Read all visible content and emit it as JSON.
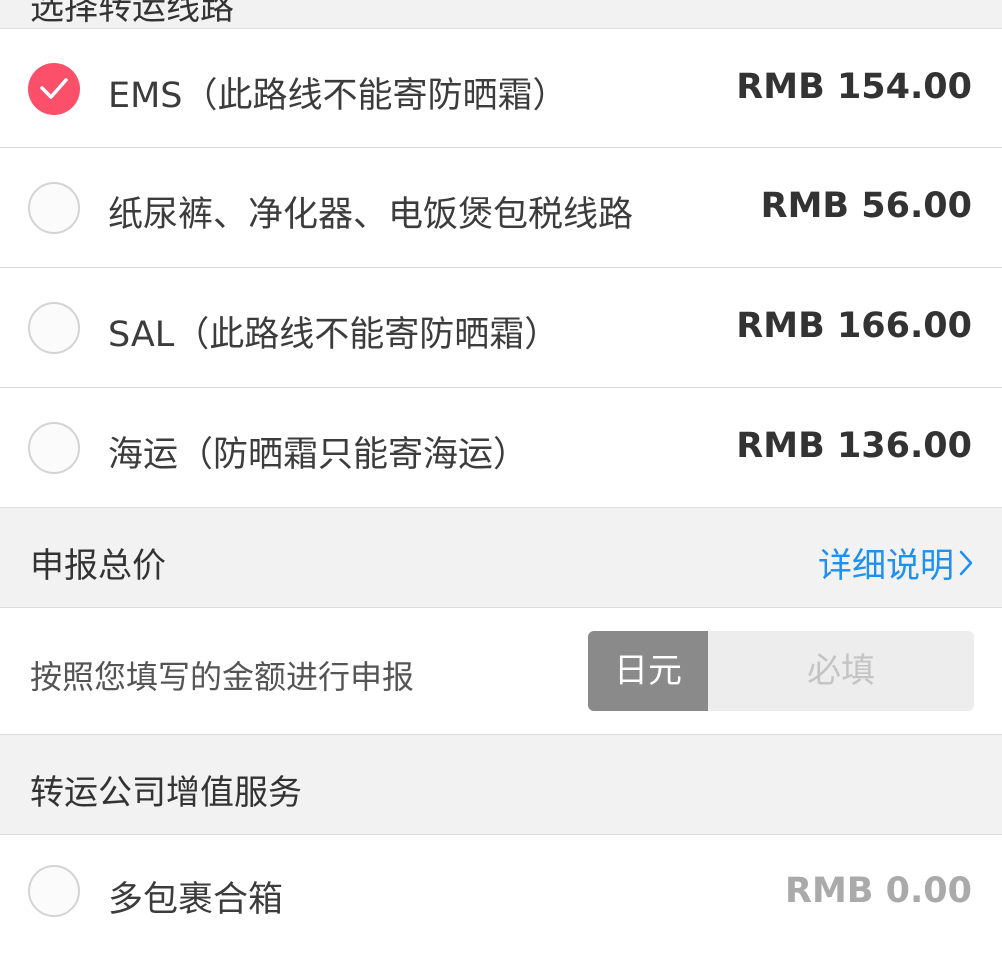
{
  "route_section": {
    "title": "选择转运线路",
    "options": [
      {
        "label": "EMS（此路线不能寄防晒霜）",
        "price": "RMB 154.00",
        "selected": true
      },
      {
        "label": "纸尿裤、净化器、电饭煲包税线路",
        "price": "RMB 56.00",
        "selected": false
      },
      {
        "label": "SAL（此路线不能寄防晒霜）",
        "price": "RMB 166.00",
        "selected": false
      },
      {
        "label": "海运（防晒霜只能寄海运）",
        "price": "RMB 136.00",
        "selected": false
      }
    ]
  },
  "declare_section": {
    "title": "申报总价",
    "detail_link": "详细说明",
    "description": "按照您填写的金额进行申报",
    "currency_unit": "日元",
    "amount_placeholder": "必填"
  },
  "service_section": {
    "title": "转运公司增值服务",
    "options": [
      {
        "label": "多包裹合箱",
        "price": "RMB 0.00",
        "selected": false
      }
    ]
  },
  "colors": {
    "accent_selected": "#fb4f6a",
    "link": "#1e90f0",
    "unit_badge": "#8a8a8a"
  }
}
